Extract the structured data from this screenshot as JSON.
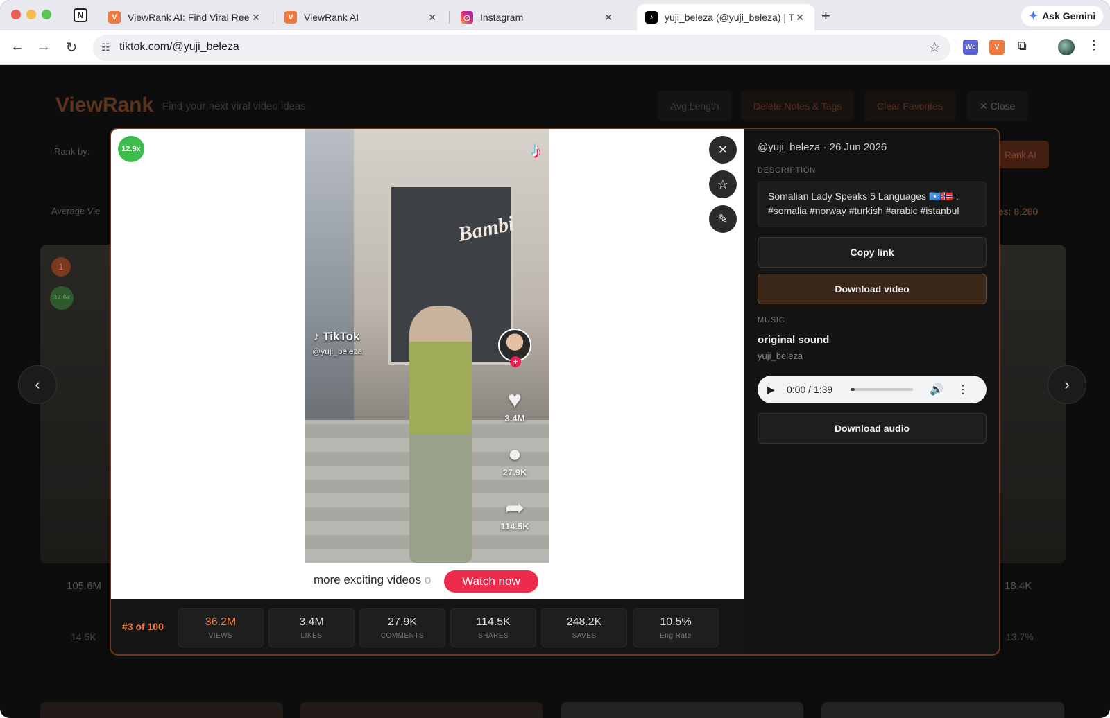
{
  "browser": {
    "pinned_tab_icon": "notion-icon",
    "tabs": [
      {
        "title": "ViewRank AI: Find Viral Reels",
        "icon": "viewrank-icon"
      },
      {
        "title": "ViewRank AI",
        "icon": "viewrank-icon"
      },
      {
        "title": "Instagram",
        "icon": "instagram-icon"
      },
      {
        "title": "yuji_beleza (@yuji_beleza) | T",
        "icon": "tiktok-icon"
      }
    ],
    "url": "tiktok.com/@yuji_beleza",
    "gemini_label": "Ask Gemini"
  },
  "page": {
    "brand": "ViewRank",
    "tagline": "Find your next viral video ideas",
    "header_buttons": [
      "Avg Length",
      "Delete Notes & Tags",
      "Clear Favorites",
      "✕ Close"
    ],
    "rank_by_label": "Rank by:",
    "rank_ai_label": "Rank AI",
    "average_label": "Average Vie",
    "average_right_label": "res:",
    "average_right_value": "8,280",
    "bg_card_stats": {
      "left_views": "105.6M",
      "left_shares": "14.5K",
      "right_comments": "18.4K",
      "right_rate": "13.7%"
    },
    "bg_card_badges": {
      "rank": "1",
      "mult": "37.6x"
    }
  },
  "modal": {
    "multiplier": "12.9x",
    "video": {
      "watermark": "TikTok",
      "watermark_handle": "@yuji_beleza",
      "sign_text": "Bambi",
      "likes": "3.4M",
      "comments": "27.9K",
      "shares": "114.5K",
      "footer_text": "more exciting videos ",
      "footer_fade": "o",
      "watch_now": "Watch now"
    },
    "stats": {
      "position": "#3 of 100",
      "items": [
        {
          "value": "36.2M",
          "label": "VIEWS"
        },
        {
          "value": "3.4M",
          "label": "LIKES"
        },
        {
          "value": "27.9K",
          "label": "COMMENTS"
        },
        {
          "value": "114.5K",
          "label": "SHARES"
        },
        {
          "value": "248.2K",
          "label": "SAVES"
        },
        {
          "value": "10.5%",
          "label": "Eng Rate"
        }
      ]
    },
    "panel": {
      "byline": "@yuji_beleza · 26 Jun 2026",
      "description_label": "DESCRIPTION",
      "description": "Somalian Lady Speaks 5 Languages 🇸🇴🇳🇴 . #somalia #norway #turkish #arabic #istanbul",
      "copy_link": "Copy link",
      "download_video": "Download video",
      "music_label": "MUSIC",
      "song": "original sound",
      "artist": "yuji_beleza",
      "player_time": "0:00 / 1:39",
      "player_progress": 0.0,
      "download_audio": "Download audio"
    }
  },
  "colors": {
    "accent": "#f07a3d",
    "watch": "#ee2a4f",
    "multiplier": "#3dbb4d"
  }
}
